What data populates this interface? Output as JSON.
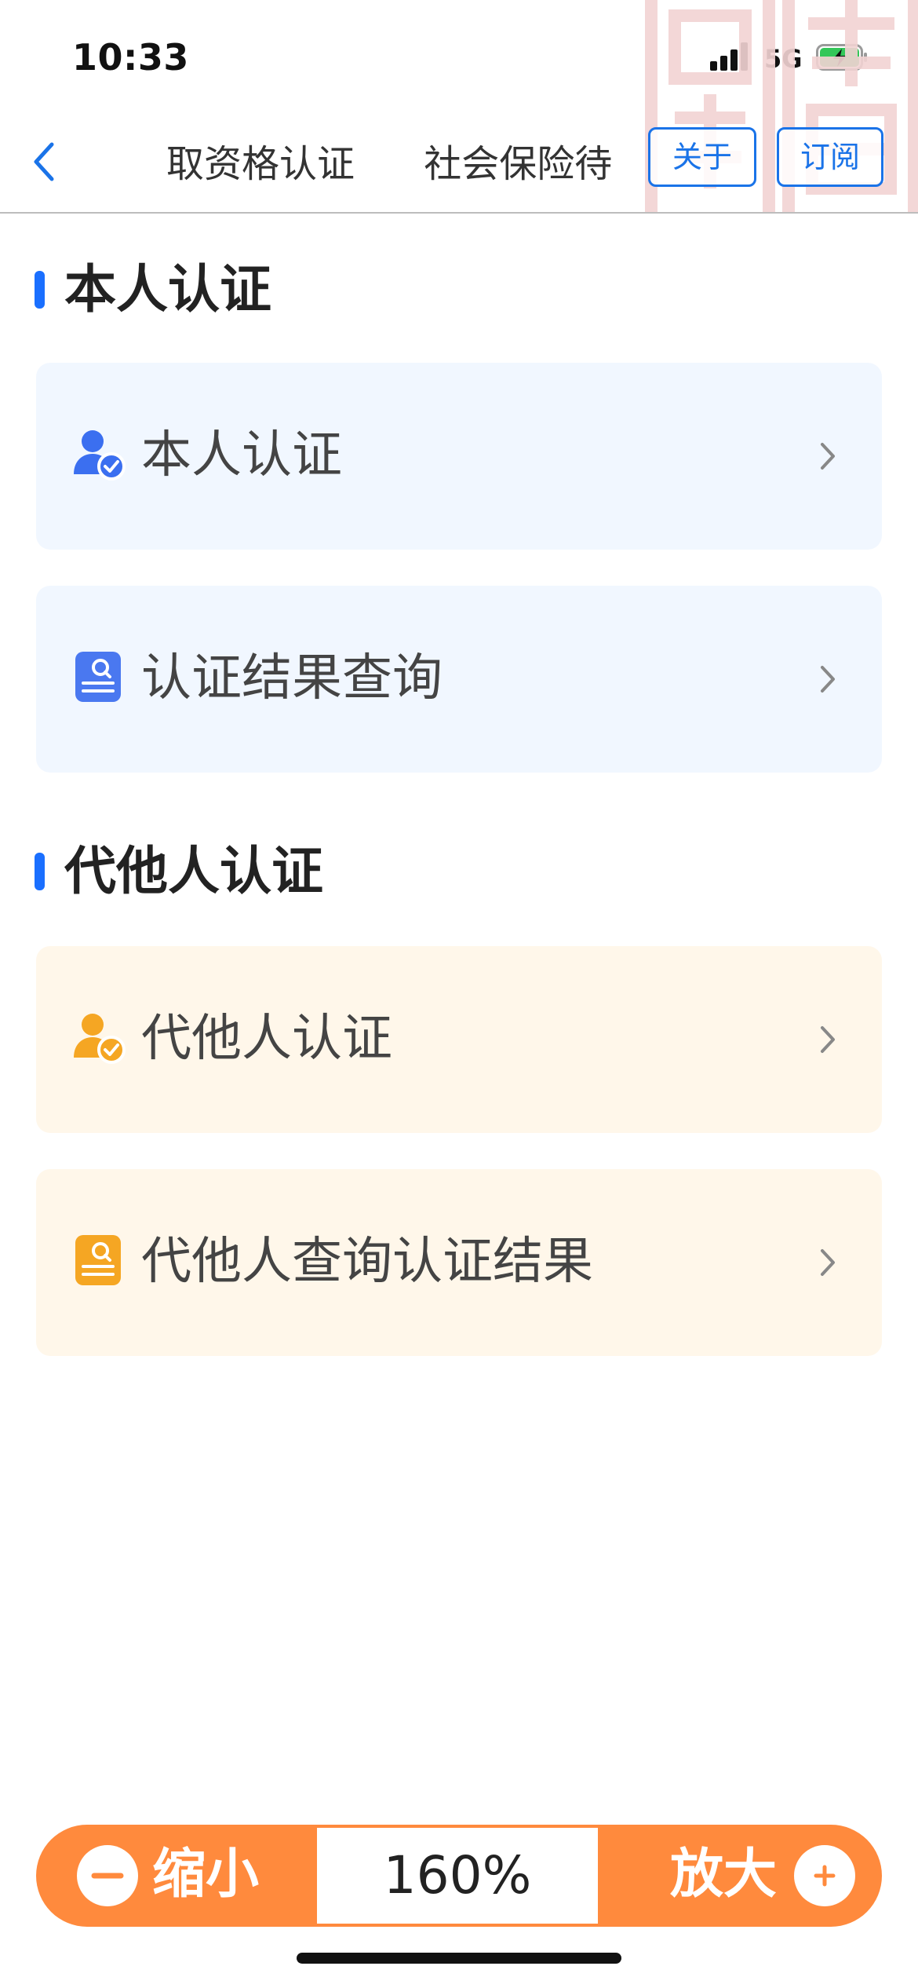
{
  "status_bar": {
    "time": "10:33",
    "network": "5G"
  },
  "nav": {
    "title_segments": [
      "取资格认证",
      "社会保险待"
    ],
    "about_label": "关于",
    "subscribe_label": "订阅"
  },
  "sections": [
    {
      "title": "本人认证",
      "items": [
        {
          "label": "本人认证",
          "icon": "user-check-icon"
        },
        {
          "label": "认证结果查询",
          "icon": "document-search-icon"
        }
      ]
    },
    {
      "title": "代他人认证",
      "items": [
        {
          "label": "代他人认证",
          "icon": "user-check-icon"
        },
        {
          "label": "代他人查询认证结果",
          "icon": "document-search-icon"
        }
      ]
    }
  ],
  "zoom": {
    "zoom_out_label": "缩小",
    "zoom_in_label": "放大",
    "value": "160%"
  },
  "colors": {
    "accent_blue": "#1a73e8",
    "accent_orange": "#ff8a3d",
    "card_blue_bg": "#f1f7ff",
    "card_orange_bg": "#fff7ea"
  }
}
